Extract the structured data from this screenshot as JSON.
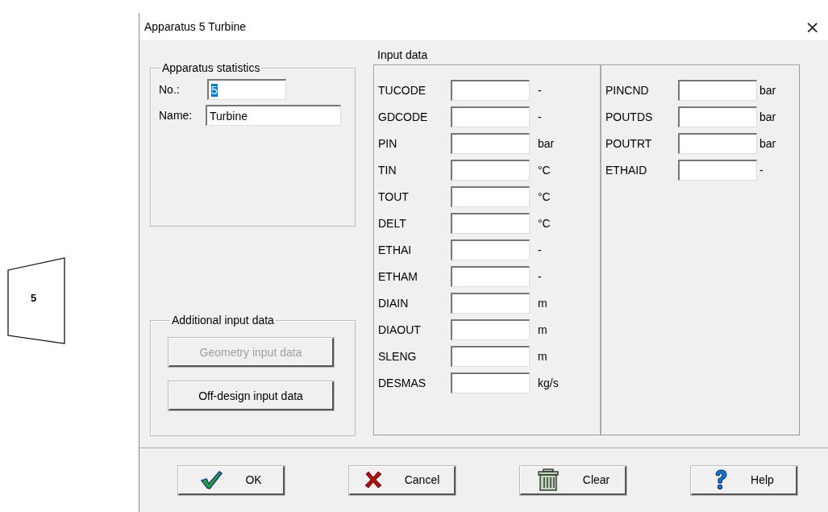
{
  "diagram": {
    "label": "5"
  },
  "window": {
    "title": "Apparatus 5  Turbine",
    "close": "×"
  },
  "apparatus_statistics": {
    "title": "Apparatus statistics",
    "fields": [
      {
        "label": "No.:",
        "value": "5",
        "highlighted": true
      },
      {
        "label": "Name:",
        "value": "Turbine",
        "highlighted": false
      }
    ]
  },
  "additional_input_data": {
    "title": "Additional input data",
    "buttons": [
      {
        "label": "Geometry input data",
        "disabled": true
      },
      {
        "label": "Off-design input data",
        "disabled": false
      }
    ]
  },
  "input_data": {
    "title": "Input data",
    "columns": [
      [
        {
          "label": "TUCODE",
          "unit": "-"
        },
        {
          "label": "GDCODE",
          "unit": "-"
        },
        {
          "label": "PIN",
          "unit": "bar"
        },
        {
          "label": "TIN",
          "unit": "°C"
        },
        {
          "label": "TOUT",
          "unit": "°C"
        },
        {
          "label": "DELT",
          "unit": "°C"
        },
        {
          "label": "ETHAI",
          "unit": "-"
        },
        {
          "label": "ETHAM",
          "unit": "-"
        },
        {
          "label": "DIAIN",
          "unit": "m"
        },
        {
          "label": "DIAOUT",
          "unit": "m"
        },
        {
          "label": "SLENG",
          "unit": "m"
        },
        {
          "label": "DESMAS",
          "unit": "kg/s"
        }
      ],
      [
        {
          "label": "PINCND",
          "unit": "bar"
        },
        {
          "label": "POUTDS",
          "unit": "bar"
        },
        {
          "label": "POUTRT",
          "unit": "bar"
        },
        {
          "label": "ETHAID",
          "unit": "-"
        }
      ]
    ]
  },
  "buttons": [
    {
      "kind": "ok",
      "label": "OK"
    },
    {
      "kind": "cancel",
      "label": "Cancel"
    },
    {
      "kind": "clear",
      "label": "Clear"
    },
    {
      "kind": "help",
      "label": "Help"
    }
  ]
}
